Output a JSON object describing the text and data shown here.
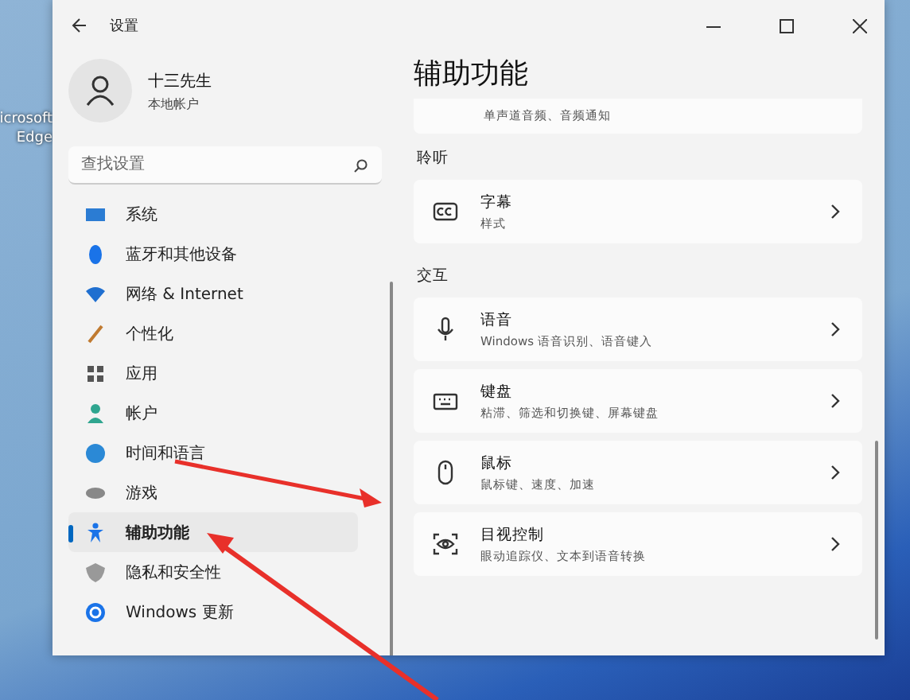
{
  "desktop": {
    "icon_labels": [
      "icrosoft",
      "Edge"
    ]
  },
  "window": {
    "title": "设置"
  },
  "user": {
    "name": "十三先生",
    "account": "本地帐户"
  },
  "search": {
    "placeholder": "查找设置"
  },
  "nav": [
    {
      "label": "系统",
      "selected": false
    },
    {
      "label": "蓝牙和其他设备",
      "selected": false
    },
    {
      "label": "网络 & Internet",
      "selected": false
    },
    {
      "label": "个性化",
      "selected": false
    },
    {
      "label": "应用",
      "selected": false
    },
    {
      "label": "帐户",
      "selected": false
    },
    {
      "label": "时间和语言",
      "selected": false
    },
    {
      "label": "游戏",
      "selected": false
    },
    {
      "label": "辅助功能",
      "selected": true
    },
    {
      "label": "隐私和安全性",
      "selected": false
    },
    {
      "label": "Windows 更新",
      "selected": false
    }
  ],
  "page_title": "辅助功能",
  "content": [
    {
      "kind": "partial",
      "subtitle": "单声道音频、音频通知"
    },
    {
      "kind": "heading",
      "text": "聆听"
    },
    {
      "kind": "card",
      "title": "字幕",
      "subtitle": "样式"
    },
    {
      "kind": "heading",
      "text": "交互"
    },
    {
      "kind": "card",
      "title": "语音",
      "subtitle": "Windows 语音识别、语音键入"
    },
    {
      "kind": "card",
      "title": "键盘",
      "subtitle": "粘滞、筛选和切换键、屏幕键盘"
    },
    {
      "kind": "card",
      "title": "鼠标",
      "subtitle": "鼠标键、速度、加速"
    },
    {
      "kind": "card",
      "title": "目视控制",
      "subtitle": "眼动追踪仪、文本到语音转换"
    }
  ]
}
